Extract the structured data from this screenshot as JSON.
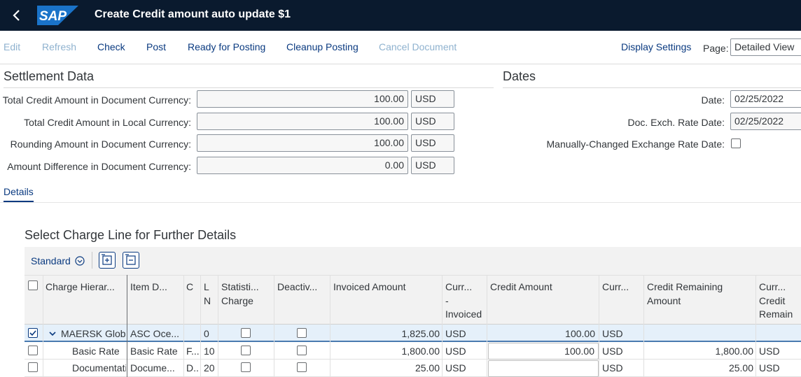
{
  "shell": {
    "title": "Create Credit amount auto update $1",
    "logo_text": "SAP",
    "colors": {
      "shell_bg": "#0a1a2e",
      "logo": "#1a73c9",
      "link": "#0a3a80"
    }
  },
  "toolbar": {
    "edit": "Edit",
    "refresh": "Refresh",
    "check": "Check",
    "post": "Post",
    "ready_for_posting": "Ready for Posting",
    "cleanup_posting": "Cleanup Posting",
    "cancel_document": "Cancel Document",
    "display_settings": "Display Settings",
    "page_label": "Page:",
    "page_value": "Detailed View"
  },
  "settlement": {
    "title": "Settlement Data",
    "fields": [
      {
        "label": "Total Credit Amount in Document Currency:",
        "value": "100.00",
        "currency": "USD"
      },
      {
        "label": "Total Credit Amount in Local Currency:",
        "value": "100.00",
        "currency": "USD"
      },
      {
        "label": "Rounding Amount in Document Currency:",
        "value": "100.00",
        "currency": "USD"
      },
      {
        "label": "Amount Difference in Document Currency:",
        "value": "0.00",
        "currency": "USD"
      }
    ]
  },
  "dates": {
    "title": "Dates",
    "date_label": "Date:",
    "date_value": "02/25/2022",
    "exch_label": "Doc. Exch. Rate Date:",
    "exch_value": "02/25/2022",
    "manual_label": "Manually-Changed Exchange Rate Date:",
    "manual_checked": false
  },
  "tabs": {
    "details": "Details"
  },
  "table": {
    "title": "Select Charge Line for Further Details",
    "variant": "Standard",
    "headers": {
      "charge": "Charge Hierar...",
      "item": "Item D...",
      "c": "C",
      "ln1": "L",
      "ln2": "N",
      "stat1": "Statisti...",
      "stat2": "Charge",
      "deact": "Deactiv...",
      "invoiced": "Invoiced Amount",
      "curr_inv1": "Curr...",
      "curr_inv2": "-",
      "curr_inv3": "Invoiced",
      "credit": "Credit Amount",
      "curr_cr": "Curr...",
      "remain1": "Credit Remaining",
      "remain2": "Amount",
      "curr_rem1": "Curr...",
      "curr_rem2": "Credit",
      "curr_rem3": "Remain"
    },
    "rows": [
      {
        "selected": true,
        "charge": "MAERSK Globa",
        "item": "ASC Oce...",
        "c": "",
        "ln": "0",
        "invoiced": "1,825.00",
        "curr_inv": "USD",
        "credit": "100.00",
        "curr_cr": "USD",
        "remaining": "",
        "curr_rem": ""
      },
      {
        "selected": false,
        "charge": "Basic Rate",
        "item": "Basic Rate",
        "c": "F...",
        "ln": "10",
        "invoiced": "1,800.00",
        "curr_inv": "USD",
        "credit": "100.00",
        "curr_cr": "USD",
        "remaining": "1,800.00",
        "curr_rem": "USD"
      },
      {
        "selected": false,
        "charge": "Documentati",
        "item": "Docume...",
        "c": "D...",
        "ln": "20",
        "invoiced": "25.00",
        "curr_inv": "USD",
        "credit": "",
        "curr_cr": "USD",
        "remaining": "25.00",
        "curr_rem": "USD"
      }
    ]
  }
}
